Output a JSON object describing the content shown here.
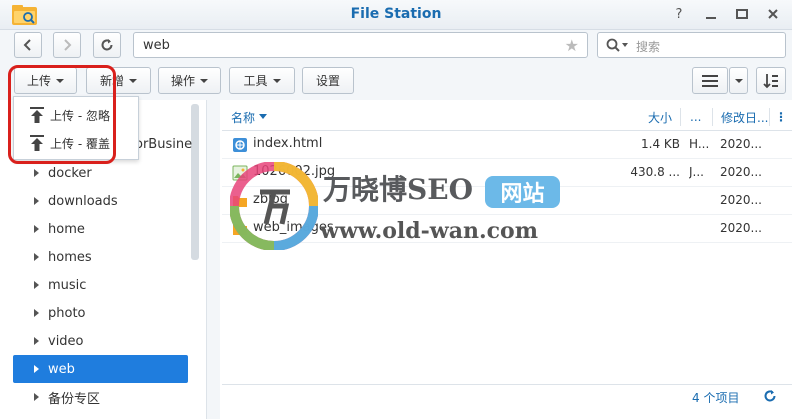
{
  "window": {
    "title": "File Station"
  },
  "toolbar": {
    "path_value": "web",
    "search_placeholder": "搜索",
    "upload_label": "上传",
    "new_label": "新增",
    "action_label": "操作",
    "tools_label": "工具",
    "settings_label": "设置"
  },
  "upload_menu": {
    "items": [
      {
        "label": "上传 - 忽略"
      },
      {
        "label": "上传 - 覆盖"
      }
    ]
  },
  "tree": {
    "partial_label": "orBusine",
    "items": [
      {
        "label": "docker"
      },
      {
        "label": "downloads"
      },
      {
        "label": "home"
      },
      {
        "label": "homes"
      },
      {
        "label": "music"
      },
      {
        "label": "photo"
      },
      {
        "label": "video"
      },
      {
        "label": "web",
        "selected": true
      },
      {
        "label": "备份专区"
      }
    ]
  },
  "file_list": {
    "columns": {
      "name": "名称",
      "size": "大小",
      "type": "...",
      "modified": "修改日..."
    },
    "rows": [
      {
        "name": "index.html",
        "size": "1.4 KB",
        "type": "H...",
        "modified": "2020...",
        "icon": "html-file-icon"
      },
      {
        "name": "1026002.jpg",
        "size": "430.8 ...",
        "type": "J...",
        "modified": "2020...",
        "icon": "image-file-icon"
      },
      {
        "name": "zblog",
        "size": "",
        "type": "",
        "modified": "2020...",
        "icon": "folder-icon"
      },
      {
        "name": "web_images",
        "size": "",
        "type": "",
        "modified": "2020...",
        "icon": "folder-icon"
      }
    ],
    "footer_count": "4 个项目"
  },
  "watermark": {
    "title": "万晓博SEO",
    "badge": "网站",
    "url": "www.old-wan.com"
  },
  "colors": {
    "accent": "#1f7dde",
    "title": "#1a6cb0",
    "highlight": "#d9201c",
    "folder": "#f5a623"
  }
}
